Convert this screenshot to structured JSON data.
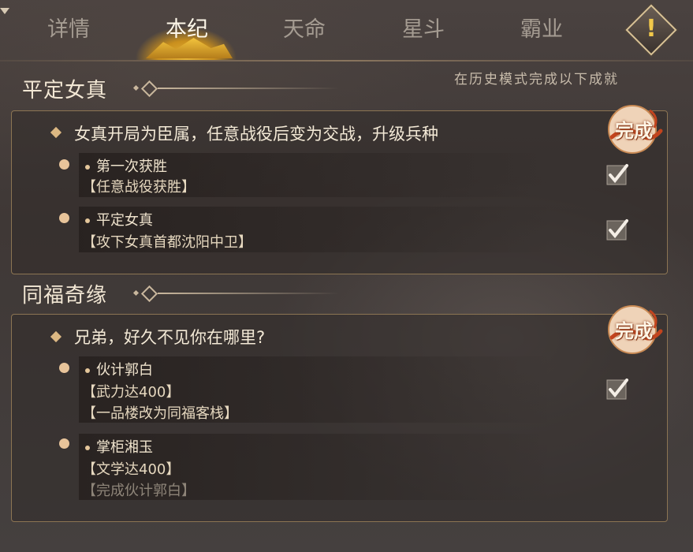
{
  "tabs": [
    {
      "label": "详情",
      "active": false
    },
    {
      "label": "本纪",
      "active": true
    },
    {
      "label": "天命",
      "active": false
    },
    {
      "label": "星斗",
      "active": false
    },
    {
      "label": "霸业",
      "active": false
    }
  ],
  "alert_icon": "exclamation-icon",
  "hint": "在历史模式完成以下成就",
  "sections": [
    {
      "title": "平定女真",
      "goal": "女真开局为臣属，任意战役后变为交战，升级兵种",
      "stamp": "完成",
      "items": [
        {
          "name": "第一次获胜",
          "reqs": [
            "【任意战役获胜】"
          ],
          "checked": true
        },
        {
          "name": "平定女真",
          "reqs": [
            "【攻下女真首都沈阳中卫】"
          ],
          "checked": true
        }
      ]
    },
    {
      "title": "同福奇缘",
      "goal": "兄弟，好久不见你在哪里?",
      "stamp": "完成",
      "items": [
        {
          "name": "伙计郭白",
          "reqs": [
            "【武力达400】",
            "【一品楼改为同福客栈】"
          ],
          "checked": true
        },
        {
          "name": "掌柜湘玉",
          "reqs": [
            "【文学达400】",
            "【完成伙计郭白】"
          ],
          "checked": false
        }
      ]
    }
  ],
  "colors": {
    "accent_gold": "#e7b538",
    "panel_border": "#8c7553",
    "stamp_red": "#c2441e"
  }
}
